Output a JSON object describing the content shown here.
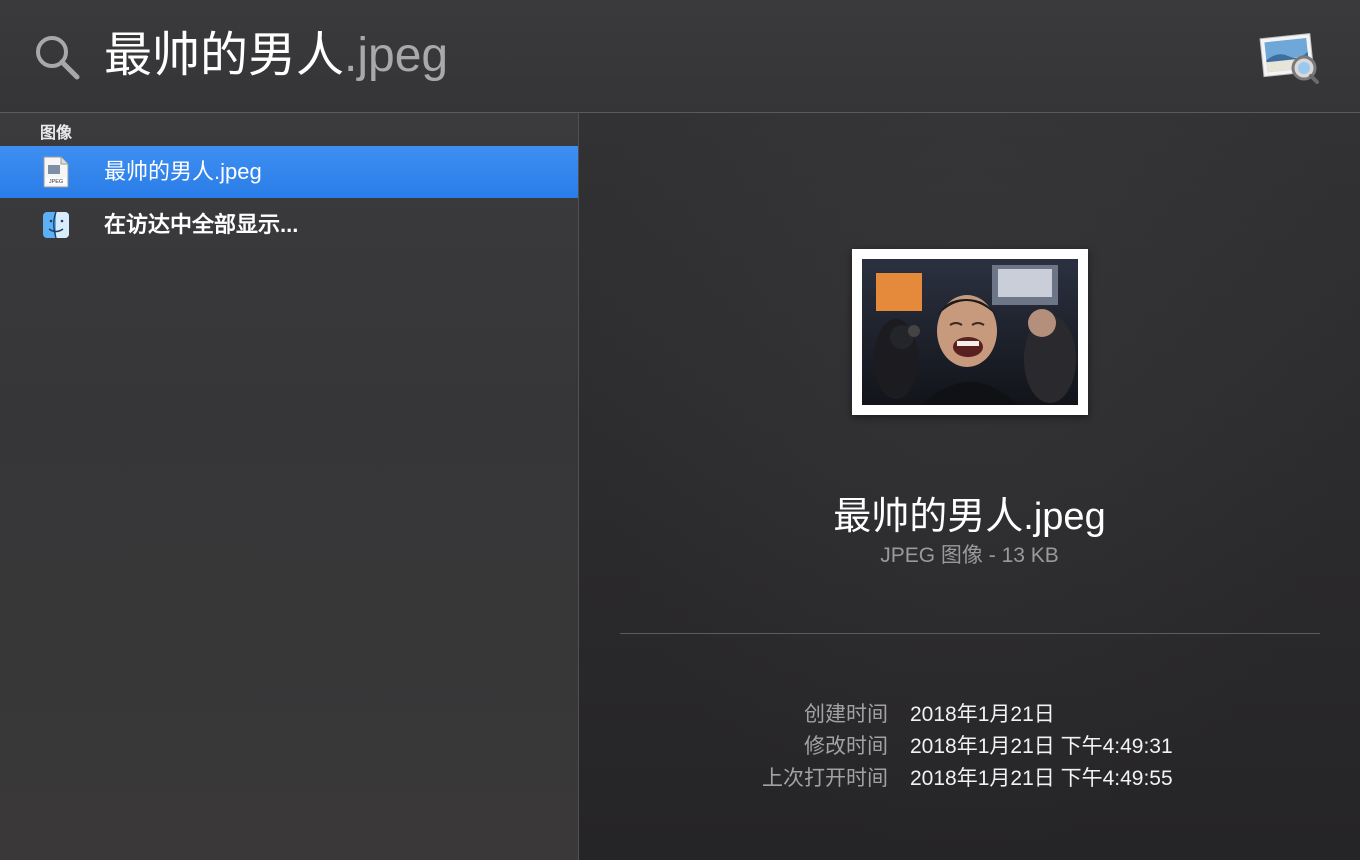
{
  "search": {
    "typed": "最帅的男人",
    "completion": ".jpeg"
  },
  "icons": {
    "search": "search-icon",
    "preview_app": "preview-app-icon",
    "jpeg_file": "jpeg-file-icon",
    "finder": "finder-icon"
  },
  "results": {
    "section_header": "图像",
    "items": [
      {
        "label": "最帅的男人.jpeg",
        "selected": true
      },
      {
        "label": "在访达中全部显示...",
        "selected": false
      }
    ]
  },
  "preview": {
    "title": "最帅的男人.jpeg",
    "kind": "JPEG 图像 - 13 KB",
    "metadata": [
      {
        "key": "创建时间",
        "value": "2018年1月21日"
      },
      {
        "key": "修改时间",
        "value": "2018年1月21日 下午4:49:31"
      },
      {
        "key": "上次打开时间",
        "value": "2018年1月21日 下午4:49:55"
      }
    ]
  },
  "colors": {
    "selection": "#2a7de8",
    "background": "#2f2f31"
  }
}
